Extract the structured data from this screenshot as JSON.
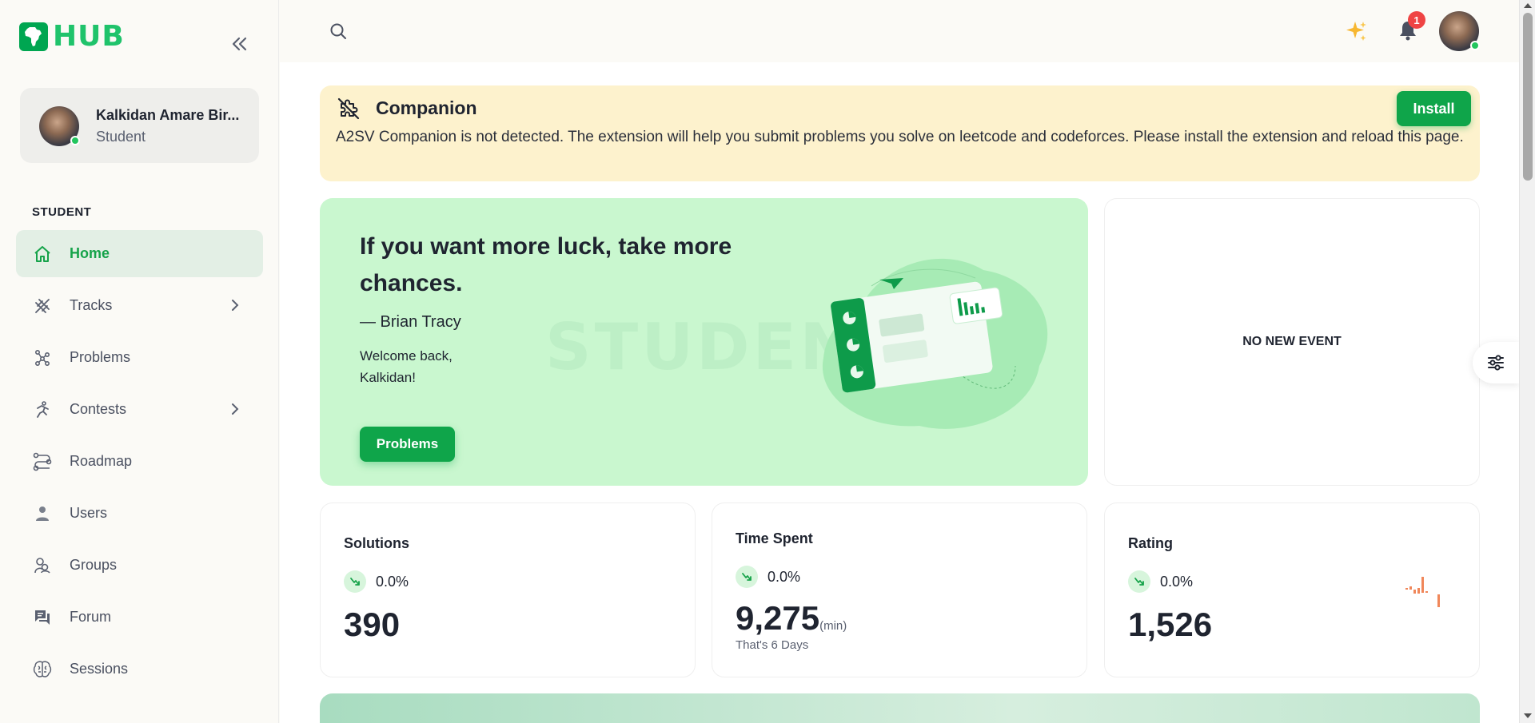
{
  "app": {
    "logo_text": "HUB"
  },
  "profile": {
    "name": "Kalkidan Amare Bir...",
    "role": "Student"
  },
  "sidebar": {
    "section_label": "STUDENT",
    "items": [
      {
        "label": "Home",
        "icon": "home-icon",
        "active": true,
        "has_chevron": false
      },
      {
        "label": "Tracks",
        "icon": "tracks-icon",
        "active": false,
        "has_chevron": true
      },
      {
        "label": "Problems",
        "icon": "problems-icon",
        "active": false,
        "has_chevron": false
      },
      {
        "label": "Contests",
        "icon": "contests-icon",
        "active": false,
        "has_chevron": true
      },
      {
        "label": "Roadmap",
        "icon": "roadmap-icon",
        "active": false,
        "has_chevron": false
      },
      {
        "label": "Users",
        "icon": "users-icon",
        "active": false,
        "has_chevron": false
      },
      {
        "label": "Groups",
        "icon": "groups-icon",
        "active": false,
        "has_chevron": false
      },
      {
        "label": "Forum",
        "icon": "forum-icon",
        "active": false,
        "has_chevron": false
      },
      {
        "label": "Sessions",
        "icon": "sessions-icon",
        "active": false,
        "has_chevron": false
      }
    ]
  },
  "topbar": {
    "notification_count": "1"
  },
  "companion": {
    "title": "Companion",
    "text": "A2SV Companion is not detected. The extension will help you submit problems you solve on leetcode and codeforces. Please install the extension and reload this page.",
    "install_label": "Install"
  },
  "hero": {
    "quote": "If you want more luck, take more chances.",
    "author": "— Brian Tracy",
    "welcome": "Welcome back, Kalkidan!",
    "button_label": "Problems",
    "watermark": "STUDENT"
  },
  "events": {
    "empty_text": "NO NEW EVENT"
  },
  "stats": {
    "solutions": {
      "title": "Solutions",
      "trend": "0.0%",
      "value": "390"
    },
    "time_spent": {
      "title": "Time Spent",
      "trend": "0.0%",
      "value": "9,275",
      "unit": "(min)",
      "sub": "That's 6 Days"
    },
    "rating": {
      "title": "Rating",
      "trend": "0.0%",
      "value": "1,526"
    }
  },
  "colors": {
    "accent": "#0fa54a",
    "hero_bg": "#c9f7cf",
    "companion_bg": "#fdf2cd",
    "badge": "#ef4444"
  }
}
